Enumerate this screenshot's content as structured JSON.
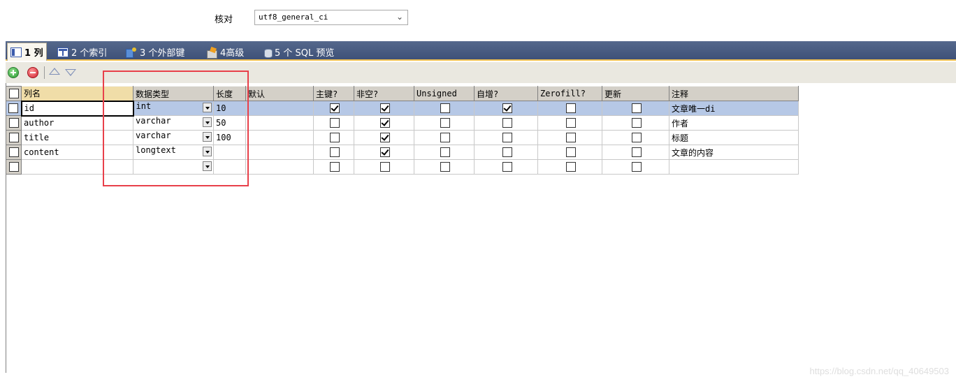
{
  "collation": {
    "label": "核对",
    "value": "utf8_general_ci"
  },
  "tabs": [
    {
      "label": "1 列",
      "icon": "columns-icon",
      "active": true
    },
    {
      "label": "2 个索引",
      "icon": "index-icon"
    },
    {
      "label": "3 个外部键",
      "icon": "foreign-key-icon"
    },
    {
      "label": "4高级",
      "icon": "advanced-icon"
    },
    {
      "label": "5 个 SQL 预览",
      "icon": "sql-preview-icon"
    }
  ],
  "toolbar": {
    "buttons": [
      "add-column-icon",
      "delete-column-icon",
      "move-up-icon",
      "move-down-icon"
    ]
  },
  "table": {
    "headers": [
      "列名",
      "数据类型",
      "长度",
      "默认",
      "主键?",
      "非空?",
      "Unsigned",
      "自增?",
      "Zerofill?",
      "更新",
      "注释"
    ],
    "rows": [
      {
        "name": "id",
        "type": "int",
        "length": "10",
        "default": "",
        "pk": true,
        "notnull": true,
        "unsigned": false,
        "autoinc": true,
        "zerofill": false,
        "update": false,
        "comment": "文章唯一di"
      },
      {
        "name": "author",
        "type": "varchar",
        "length": "50",
        "default": "",
        "pk": false,
        "notnull": true,
        "unsigned": false,
        "autoinc": false,
        "zerofill": false,
        "update": false,
        "comment": "作者"
      },
      {
        "name": "title",
        "type": "varchar",
        "length": "100",
        "default": "",
        "pk": false,
        "notnull": true,
        "unsigned": false,
        "autoinc": false,
        "zerofill": false,
        "update": false,
        "comment": "标题"
      },
      {
        "name": "content",
        "type": "longtext",
        "length": "",
        "default": "",
        "pk": false,
        "notnull": true,
        "unsigned": false,
        "autoinc": false,
        "zerofill": false,
        "update": false,
        "comment": "文章的内容"
      },
      {
        "name": "",
        "type": "",
        "length": "",
        "default": "",
        "pk": false,
        "notnull": false,
        "unsigned": false,
        "autoinc": false,
        "zerofill": false,
        "update": false,
        "comment": ""
      }
    ]
  },
  "watermark": "https://blog.csdn.net/qq_40649503",
  "colors": {
    "tabbar": "#4a5d82",
    "selected_row": "#b6c8e6",
    "highlight": "#e8404a"
  }
}
